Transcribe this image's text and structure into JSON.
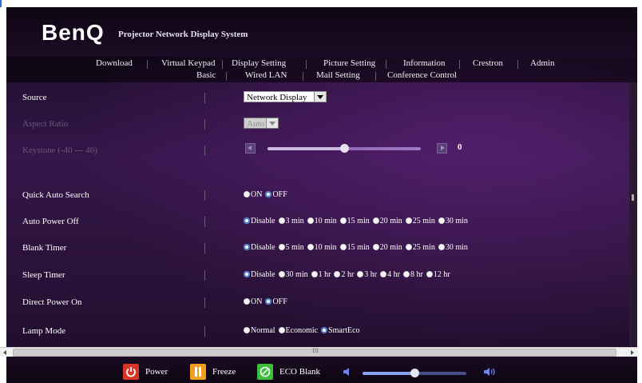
{
  "header": {
    "logo": "BenQ",
    "system_title": "Projector Network Display System"
  },
  "nav": {
    "row1": [
      "Download",
      "Virtual Keypad",
      "Display Setting",
      "Picture Setting",
      "Information",
      "Crestron",
      "Admin"
    ],
    "row2": [
      "Basic",
      "Wired LAN",
      "Mail Setting",
      "Conference Control"
    ]
  },
  "settings": {
    "source": {
      "label": "Source",
      "value": "Network Display"
    },
    "aspect_ratio": {
      "label": "Aspect Ratio",
      "value": "Auto"
    },
    "keystone": {
      "label": "Keystone (-40 --- 40)",
      "value": "0",
      "level": 0.5
    },
    "quick_auto_search": {
      "label": "Quick Auto Search",
      "options": [
        "ON",
        "OFF"
      ],
      "selected": "OFF"
    },
    "auto_power_off": {
      "label": "Auto Power Off",
      "options": [
        "Disable",
        "3 min",
        "10 min",
        "15 min",
        "20 min",
        "25 min",
        "30 min"
      ],
      "selected": "Disable"
    },
    "blank_timer": {
      "label": "Blank Timer",
      "options": [
        "Disable",
        "5 min",
        "10 min",
        "15 min",
        "20 min",
        "25 min",
        "30 min"
      ],
      "selected": "Disable"
    },
    "sleep_timer": {
      "label": "Sleep Timer",
      "options": [
        "Disable",
        "30 min",
        "1 hr",
        "2 hr",
        "3 hr",
        "4 hr",
        "8 hr",
        "12 hr"
      ],
      "selected": "Disable"
    },
    "direct_power_on": {
      "label": "Direct Power On",
      "options": [
        "ON",
        "OFF"
      ],
      "selected": "OFF"
    },
    "lamp_mode": {
      "label": "Lamp Mode",
      "options": [
        "Normal",
        "Economic",
        "SmartEco"
      ],
      "selected": "SmartEco"
    }
  },
  "toolbar": {
    "power_label": "Power",
    "freeze_label": "Freeze",
    "eco_blank_label": "ECO Blank",
    "volume_level": 0.5,
    "icons": [
      "power-icon",
      "pause-icon",
      "eco-blank-icon",
      "volume-down-icon",
      "volume-up-icon"
    ]
  },
  "colors": {
    "accent": "#4a7bd0",
    "power": "#d9352b",
    "freeze": "#f0a020",
    "eco": "#3bbf3b"
  }
}
